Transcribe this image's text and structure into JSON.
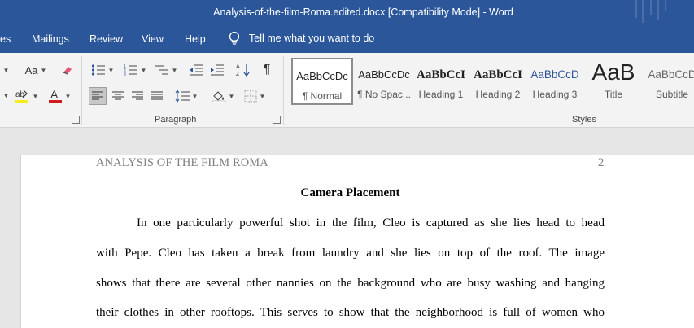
{
  "titlebar": {
    "title": "Analysis-of-the-film-Roma.edited.docx [Compatibility Mode]  -  Word"
  },
  "menu": {
    "tabs": [
      "es",
      "Mailings",
      "Review",
      "View",
      "Help"
    ],
    "tell_me": "Tell me what you want to do"
  },
  "ribbon": {
    "font_size_label": "Aa",
    "paragraph_label": "Paragraph",
    "styles_label": "Styles",
    "styles": [
      {
        "preview": "AaBbCcDc",
        "name": "¶ Normal",
        "selected": true
      },
      {
        "preview": "AaBbCcDc",
        "name": "¶ No Spac...",
        "selected": false
      },
      {
        "preview": "AaBbCcI",
        "name": "Heading 1",
        "selected": false
      },
      {
        "preview": "AaBbCcI",
        "name": "Heading 2",
        "selected": false
      },
      {
        "preview": "AaBbCcD",
        "name": "Heading 3",
        "selected": false
      },
      {
        "preview": "AaB",
        "name": "Title",
        "selected": false
      },
      {
        "preview": "AaBbCcD",
        "name": "Subtitle",
        "selected": false
      }
    ]
  },
  "document": {
    "running_head": "ANALYSIS OF THE FILM ROMA",
    "page_number": "2",
    "heading": "Camera Placement",
    "lines": [
      "In one particularly powerful shot in the film, Cleo is captured as she lies head to head",
      "with  Pepe. Cleo has taken a break from laundry and she lies on top of the roof.  The image",
      "shows that there are several other nannies on the background who are busy washing and hanging",
      "their clothes in other rooftops. This serves to show that the neighborhood is full of women who"
    ]
  },
  "colors": {
    "title_blue": "#2b579a",
    "ribbon_bg": "#f3f3f3",
    "doc_bg": "#e6e6e6"
  }
}
